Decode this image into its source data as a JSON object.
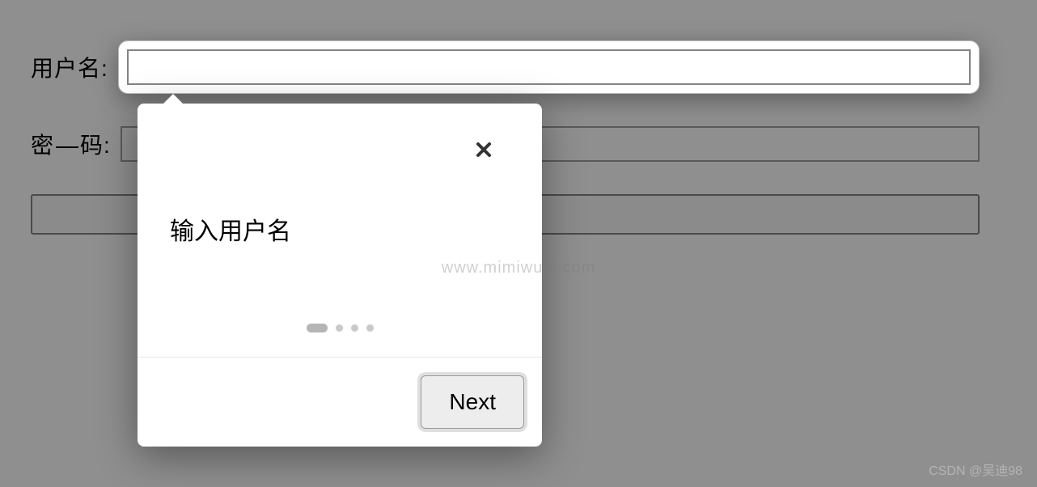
{
  "form": {
    "username_label": "用户名:",
    "password_label_prefix": "密",
    "password_label_suffix": "码:",
    "username_value": "",
    "password_value": "",
    "submit_label": ""
  },
  "tooltip": {
    "message": "输入用户名",
    "close_label": "close",
    "next_label": "Next",
    "current_step": 1,
    "total_steps": 4
  },
  "watermark": {
    "center": "www.mimiwuqi.com",
    "corner": "CSDN @吴迪98"
  }
}
